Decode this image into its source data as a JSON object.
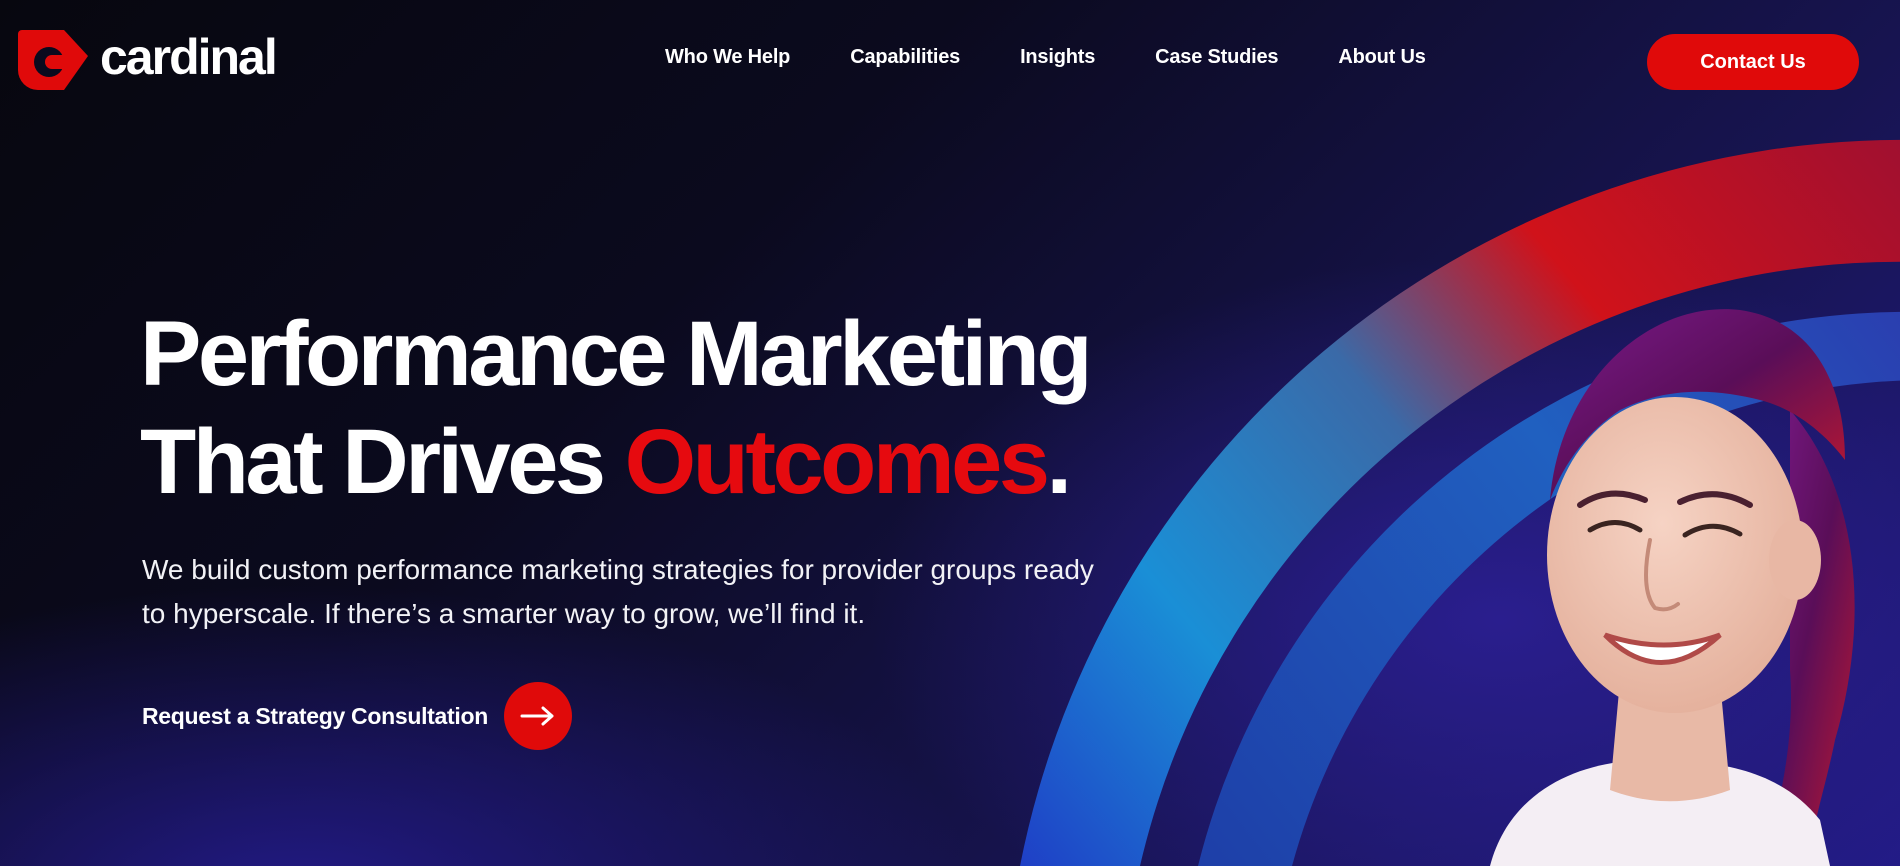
{
  "brand": {
    "name": "cardinal",
    "logo_icon": "cardinal-c-icon",
    "accent_color": "#e00a0a"
  },
  "nav": {
    "items": [
      {
        "label": "Who We Help"
      },
      {
        "label": "Capabilities"
      },
      {
        "label": "Insights"
      },
      {
        "label": "Case Studies"
      },
      {
        "label": "About Us"
      }
    ],
    "contact_label": "Contact Us"
  },
  "hero": {
    "title_line1": "Performance Marketing",
    "title_line2_prefix": "That Drives ",
    "title_highlight": "Outcomes",
    "title_suffix": ".",
    "subtitle": "We build custom performance marketing strategies for provider groups ready to hyperscale. If there’s a smarter way to grow, we’ll find it.",
    "cta_label": "Request a Strategy Consultation",
    "cta_icon": "arrow-right-icon"
  },
  "colors": {
    "background_dark": "#07070f",
    "background_indigo": "#221b86",
    "arc_red": "#d8101a",
    "arc_blue": "#1690d8"
  }
}
